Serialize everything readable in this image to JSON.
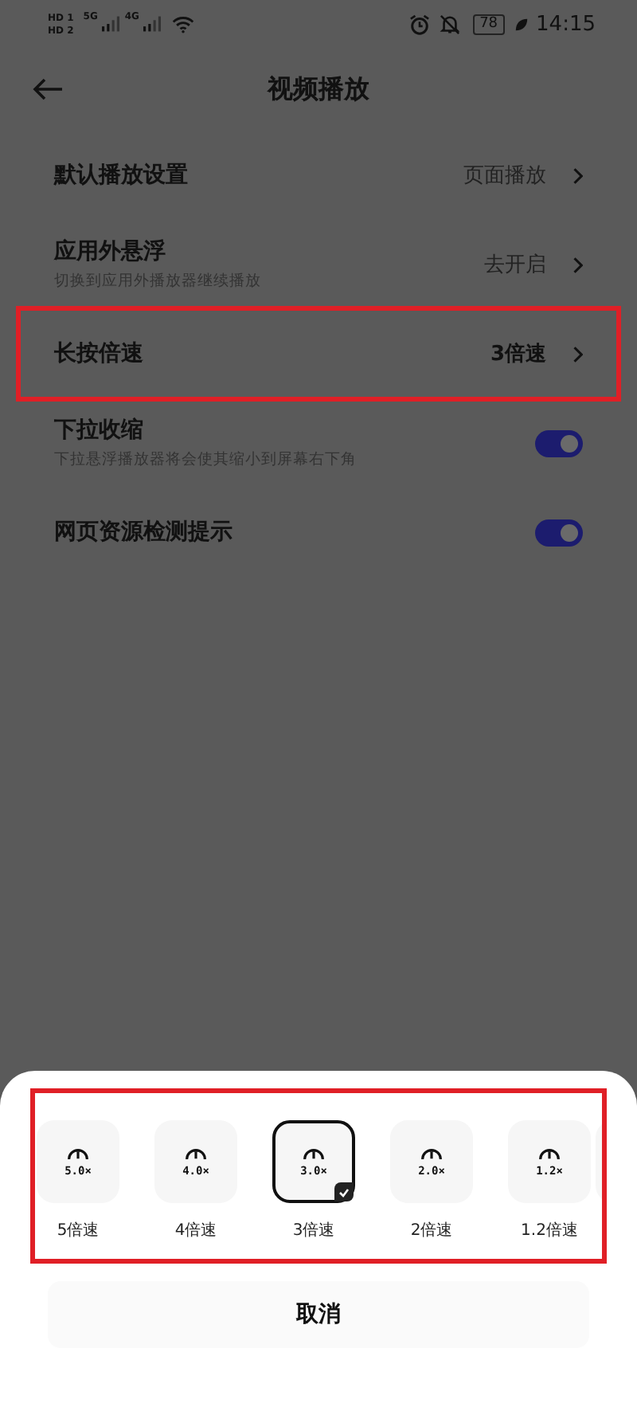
{
  "status_bar": {
    "sims": [
      "HD 1",
      "HD 2"
    ],
    "networks": [
      "5G",
      "4G"
    ],
    "battery": "78",
    "time": "14:15"
  },
  "header": {
    "title": "视频播放"
  },
  "settings": [
    {
      "kind": "link",
      "title": "默认播放设置",
      "value": "页面播放",
      "highlighted": false
    },
    {
      "kind": "link",
      "title": "应用外悬浮",
      "subtitle": "切换到应用外播放器继续播放",
      "value": "去开启",
      "highlighted": false
    },
    {
      "kind": "link",
      "title": "长按倍速",
      "value": "3倍速",
      "highlighted": true
    },
    {
      "kind": "toggle",
      "title": "下拉收缩",
      "subtitle": "下拉悬浮播放器将会使其缩小到屏幕右下角",
      "on": true,
      "highlighted": false
    },
    {
      "kind": "toggle",
      "title": "网页资源检测提示",
      "on": true,
      "highlighted": false
    }
  ],
  "speed_sheet": {
    "highlighted": true,
    "options": [
      {
        "badge": "5.0×",
        "label": "5倍速",
        "selected": false
      },
      {
        "badge": "4.0×",
        "label": "4倍速",
        "selected": false
      },
      {
        "badge": "3.0×",
        "label": "3倍速",
        "selected": true
      },
      {
        "badge": "2.0×",
        "label": "2倍速",
        "selected": false
      },
      {
        "badge": "1.2×",
        "label": "1.2倍速",
        "selected": false
      }
    ],
    "cancel": "取消"
  }
}
